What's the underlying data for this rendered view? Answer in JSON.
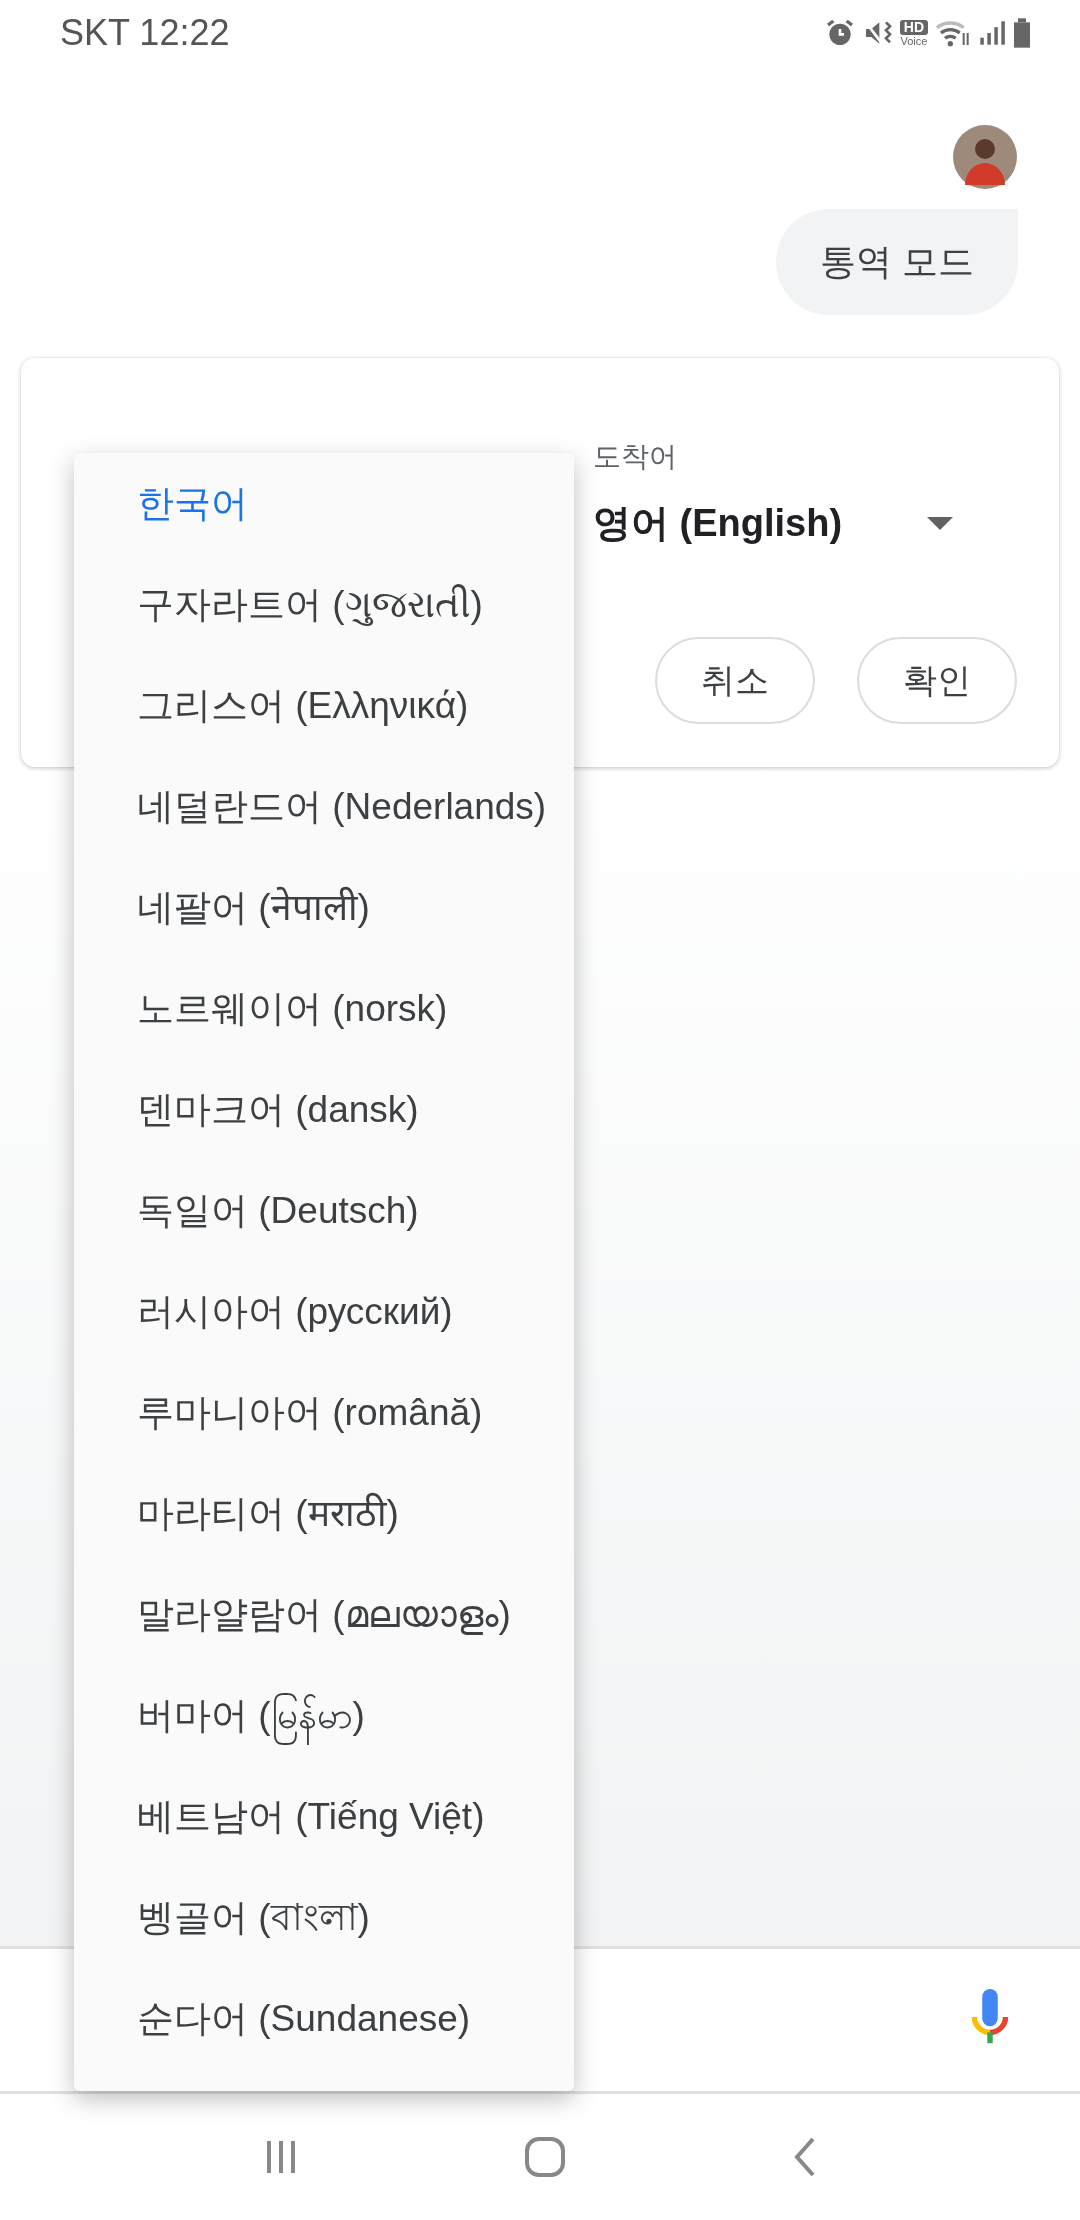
{
  "status_bar": {
    "carrier_time": "SKT 12:22",
    "hd_label": "HD",
    "voice_label": "Voice"
  },
  "chat": {
    "message": "통역 모드"
  },
  "card": {
    "target_label": "도착어",
    "target_value": "영어 (English)",
    "buttons": [
      {
        "label": "취소"
      },
      {
        "label": "확인"
      }
    ]
  },
  "menu": {
    "items": [
      {
        "label": "한국어",
        "selected": true
      },
      {
        "label": "구자라트어 (ગુજરાતી)",
        "selected": false
      },
      {
        "label": "그리스어 (Ελληνικά)",
        "selected": false
      },
      {
        "label": "네덜란드어 (Nederlands)",
        "selected": false
      },
      {
        "label": "네팔어 (नेपाली)",
        "selected": false
      },
      {
        "label": "노르웨이어 (norsk)",
        "selected": false
      },
      {
        "label": "덴마크어 (dansk)",
        "selected": false
      },
      {
        "label": "독일어 (Deutsch)",
        "selected": false
      },
      {
        "label": "러시아어 (русский)",
        "selected": false
      },
      {
        "label": "루마니아어 (română)",
        "selected": false
      },
      {
        "label": "마라티어 (मराठी)",
        "selected": false
      },
      {
        "label": "말라얄람어 (മലയാളം)",
        "selected": false
      },
      {
        "label": "버마어 (မြန်မာ)",
        "selected": false
      },
      {
        "label": "베트남어 (Tiếng Việt)",
        "selected": false
      },
      {
        "label": "벵골어 (বাংলা)",
        "selected": false
      },
      {
        "label": "순다어 (Sundanese)",
        "selected": false
      }
    ]
  }
}
